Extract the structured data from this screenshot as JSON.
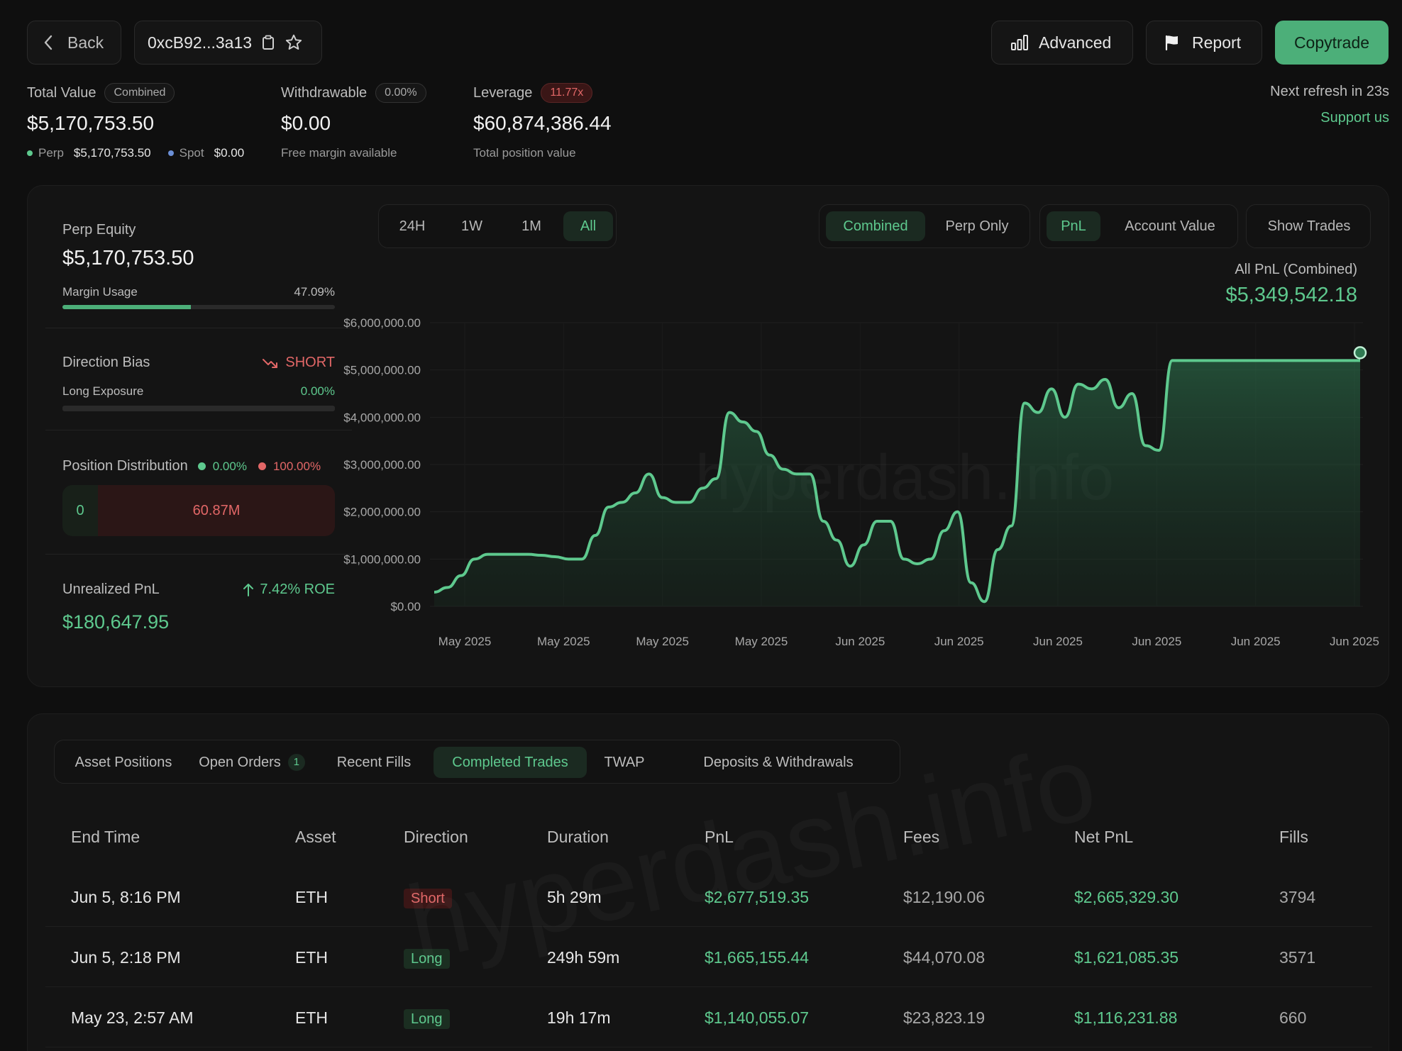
{
  "header": {
    "back_label": "Back",
    "address": "0xcB92...3a13",
    "advanced_label": "Advanced",
    "report_label": "Report",
    "copytrade_label": "Copytrade"
  },
  "stats": {
    "total_value": {
      "label": "Total Value",
      "pill": "Combined",
      "value": "$5,170,753.50",
      "perp_label": "Perp",
      "perp_value": "$5,170,753.50",
      "spot_label": "Spot",
      "spot_value": "$0.00"
    },
    "withdrawable": {
      "label": "Withdrawable",
      "pill": "0.00%",
      "value": "$0.00",
      "sub": "Free margin available"
    },
    "leverage": {
      "label": "Leverage",
      "pill": "11.77x",
      "value": "$60,874,386.44",
      "sub": "Total position value"
    },
    "refresh": "Next refresh in 23s",
    "support": "Support us"
  },
  "left": {
    "perp_equity_label": "Perp Equity",
    "perp_equity_value": "$5,170,753.50",
    "margin_usage_label": "Margin Usage",
    "margin_usage_value": "47.09%",
    "margin_usage_fraction": 0.4709,
    "direction_bias_label": "Direction Bias",
    "direction_bias_value": "SHORT",
    "long_exposure_label": "Long Exposure",
    "long_exposure_value": "0.00%",
    "long_exposure_fraction": 0,
    "position_distribution_label": "Position Distribution",
    "dist_long_pct": "0.00%",
    "dist_short_pct": "100.00%",
    "dist_long_value": "0",
    "dist_short_value": "60.87M",
    "unrealized_label": "Unrealized PnL",
    "roe": "7.42% ROE",
    "unrealized_value": "$180,647.95"
  },
  "controls": {
    "ranges": [
      "24H",
      "1W",
      "1M",
      "All"
    ],
    "active_range": "All",
    "scope": [
      "Combined",
      "Perp Only"
    ],
    "metric": [
      "PnL",
      "Account Value"
    ],
    "show_trades": "Show Trades"
  },
  "chart_data": {
    "type": "area",
    "title": "All PnL (Combined)",
    "headline_value": "$5,349,542.18",
    "watermark": "hyperdash.info",
    "y_ticks": [
      "$6,000,000.00",
      "$5,000,000.00",
      "$4,000,000.00",
      "$3,000,000.00",
      "$2,000,000.00",
      "$1,000,000.00",
      "$0.00"
    ],
    "x_ticks": [
      "May 2025",
      "May 2025",
      "May 2025",
      "May 2025",
      "Jun 2025",
      "Jun 2025",
      "Jun 2025",
      "Jun 2025",
      "Jun 2025",
      "Jun 2025"
    ],
    "ylim": [
      0,
      6000000
    ],
    "series": [
      {
        "values": [
          300000,
          400000,
          650000,
          1000000,
          1100000,
          1100000,
          1100000,
          1100000,
          1080000,
          1050000,
          1000000,
          1000000,
          1500000,
          2100000,
          2200000,
          2400000,
          2800000,
          2300000,
          2200000,
          2200000,
          2500000,
          2700000,
          4100000,
          3900000,
          3700000,
          3200000,
          2900000,
          2800000,
          2800000,
          1800000,
          1400000,
          850000,
          1300000,
          1800000,
          1800000,
          1000000,
          900000,
          1000000,
          1600000,
          2000000,
          500000,
          100000,
          1200000,
          1700000,
          4300000,
          4100000,
          4600000,
          4000000,
          4700000,
          4600000,
          4800000,
          4200000,
          4500000,
          3400000,
          3300000,
          5200000,
          5200000,
          5200000,
          5200000,
          5200000,
          5200000,
          5200000,
          5200000,
          5200000,
          5200000,
          5200000,
          5200000,
          5200000,
          5200000,
          5200000
        ]
      }
    ]
  },
  "tabs": [
    {
      "label": "Asset Positions"
    },
    {
      "label": "Open Orders",
      "badge": "1"
    },
    {
      "label": "Recent Fills"
    },
    {
      "label": "Completed Trades"
    },
    {
      "label": "TWAP"
    },
    {
      "label": "Deposits & Withdrawals"
    }
  ],
  "table": {
    "columns": [
      "End Time",
      "Asset",
      "Direction",
      "Duration",
      "PnL",
      "Fees",
      "Net PnL",
      "Fills"
    ],
    "rows": [
      {
        "end": "Jun 5, 8:16 PM",
        "asset": "ETH",
        "dir": "Short",
        "dur": "5h 29m",
        "pnl": "$2,677,519.35",
        "fees": "$12,190.06",
        "net": "$2,665,329.30",
        "fills": "3794"
      },
      {
        "end": "Jun 5, 2:18 PM",
        "asset": "ETH",
        "dir": "Long",
        "dur": "249h 59m",
        "pnl": "$1,665,155.44",
        "fees": "$44,070.08",
        "net": "$1,621,085.35",
        "fills": "3571"
      },
      {
        "end": "May 23, 2:57 AM",
        "asset": "ETH",
        "dir": "Long",
        "dur": "19h 17m",
        "pnl": "$1,140,055.07",
        "fees": "$23,823.19",
        "net": "$1,116,231.88",
        "fills": "660"
      }
    ]
  },
  "colors": {
    "accent": "#5ec98e",
    "negative": "#e26767",
    "background": "#0f0f0f"
  }
}
